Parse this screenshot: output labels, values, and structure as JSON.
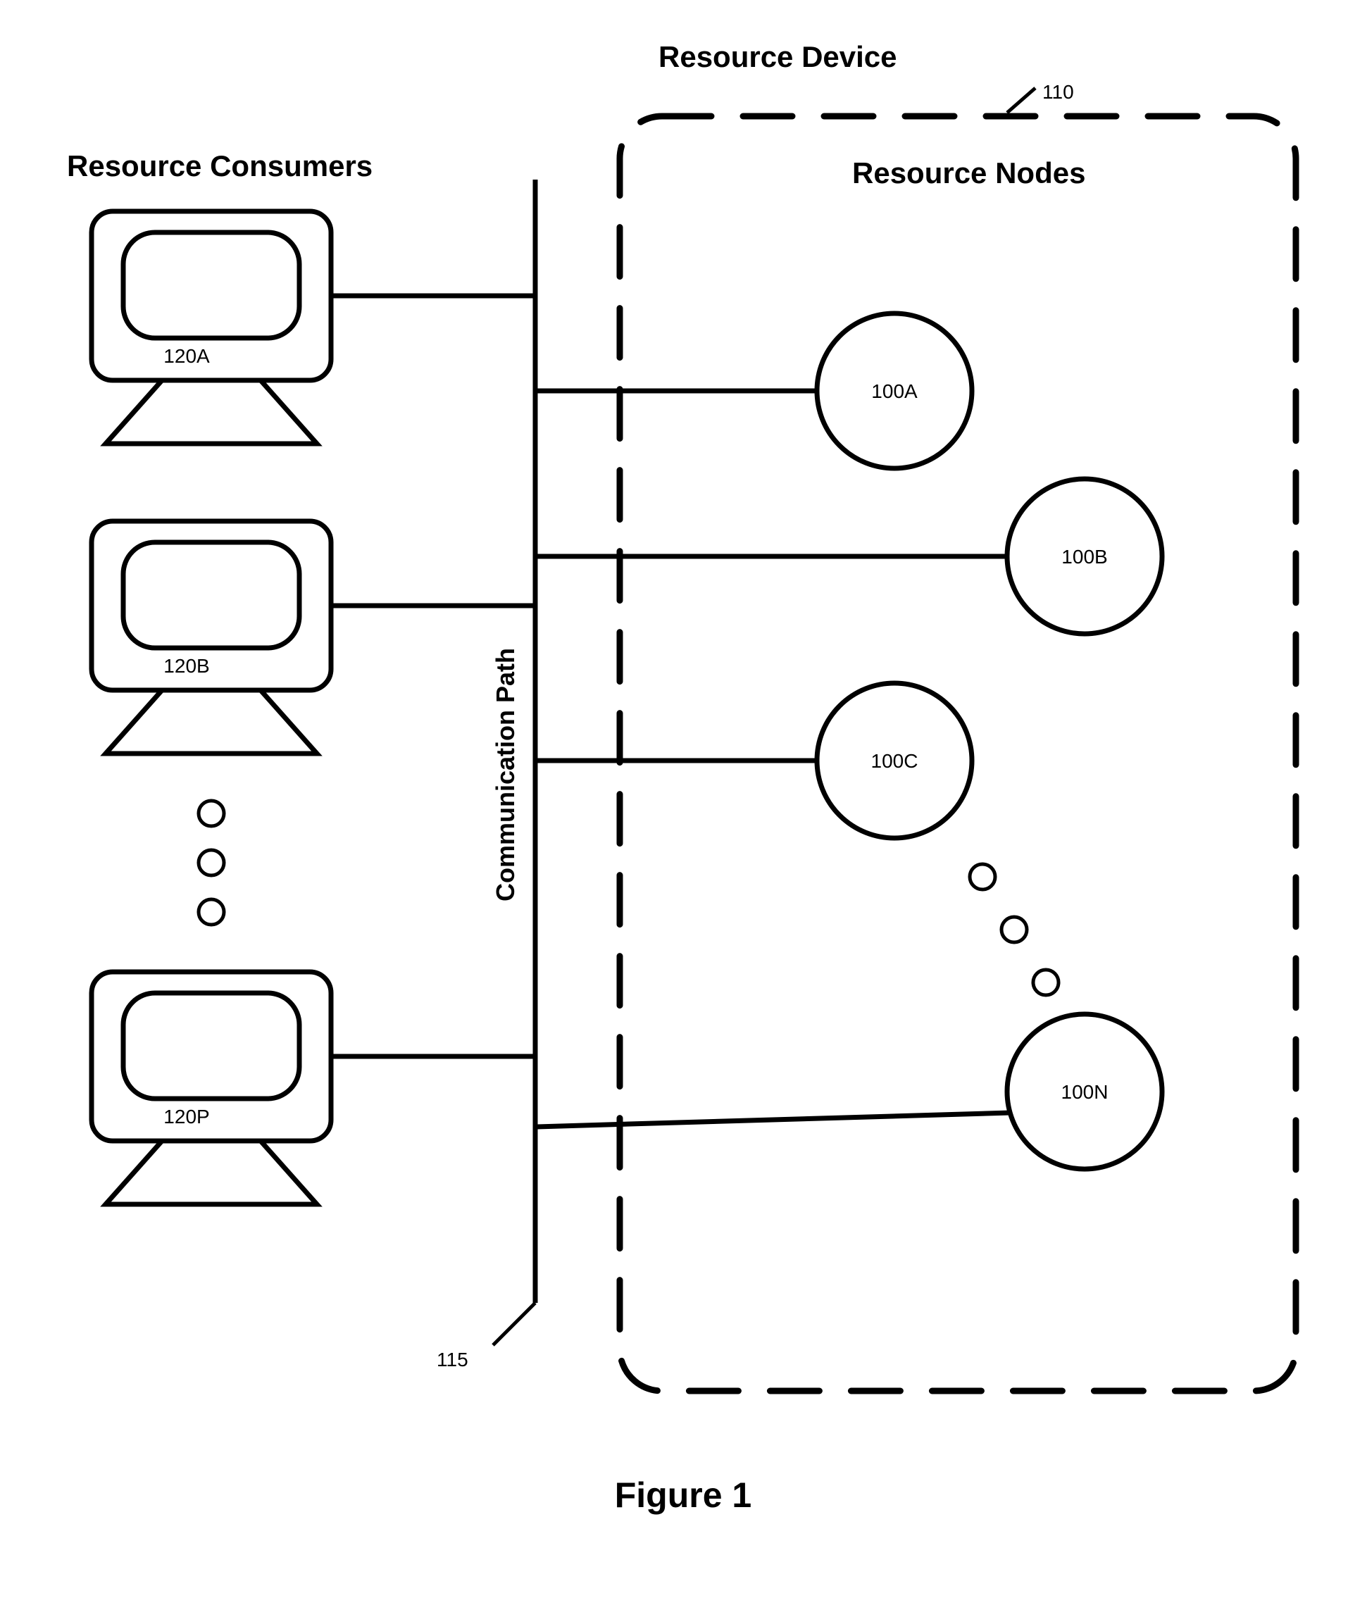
{
  "titles": {
    "resource_device": "Resource Device",
    "resource_consumers": "Resource Consumers",
    "resource_nodes": "Resource Nodes",
    "comm_path": "Communication Path",
    "figure": "Figure 1"
  },
  "refs": {
    "device_ref": "110",
    "path_ref": "115"
  },
  "consumers": [
    {
      "id": "120A"
    },
    {
      "id": "120B"
    },
    {
      "id": "120P"
    }
  ],
  "nodes": [
    {
      "id": "100A"
    },
    {
      "id": "100B"
    },
    {
      "id": "100C"
    },
    {
      "id": "100N"
    }
  ]
}
